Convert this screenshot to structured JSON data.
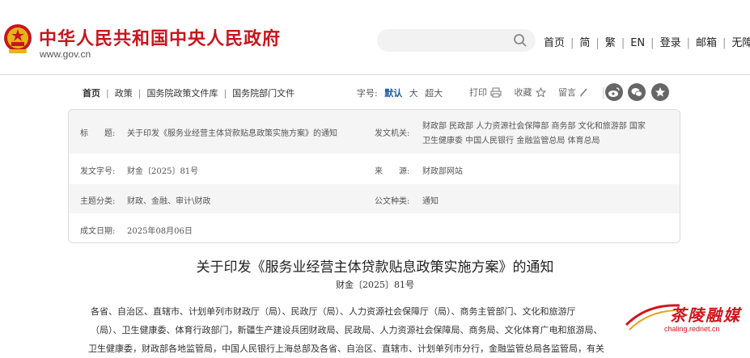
{
  "header": {
    "site_title": "中华人民共和国中央人民政府",
    "site_url": "www.gov.cn",
    "search_placeholder": "",
    "nav": [
      "首页",
      "简",
      "繁",
      "EN",
      "登录",
      "邮箱",
      "无障碍"
    ]
  },
  "toolbar": {
    "breadcrumbs": [
      "首页",
      "政策",
      "国务院政策文件库",
      "国务院部门文件"
    ],
    "fontsize_label": "字号:",
    "fontsize_options": [
      "默认",
      "大",
      "超大"
    ],
    "print_label": "打印",
    "favorite_label": "收藏",
    "message_label": "留言"
  },
  "info": {
    "title_label": "标　　题:",
    "title_value": "关于印发《服务业经营主体贷款贴息政策实施方案》的通知",
    "issuer_label": "发文机关:",
    "issuer_value_1": "财政部 民政部 人力资源社会保障部 商务部 文化和旅游部 国家",
    "issuer_value_2": "卫生健康委 中国人民银行 金融监管总局 体育总局",
    "docno_label": "发文字号:",
    "docno_value": "财金〔2025〕81号",
    "source_label": "来　　源:",
    "source_value": "财政部网站",
    "topic_label": "主题分类:",
    "topic_value": "财政、金融、审计\\财政",
    "type_label": "公文种类:",
    "type_value": "通知",
    "date_label": "成文日期:",
    "date_value": "2025年08月06日"
  },
  "document": {
    "title": "关于印发《服务业经营主体贷款贴息政策实施方案》的通知",
    "number": "财金〔2025〕81号",
    "lines": [
      "各省、自治区、直辖市、计划单列市财政厅（局）、民政厅（局）、人力资源社会保障厅（局）、商务主管部门、文化和旅游厅",
      "（局）、卫生健康委、体育行政部门，新疆生产建设兵团财政局、民政局、人力资源社会保障局、商务局、文化体育广电和旅游局、",
      "卫生健康委，财政部各地监管局，中国人民银行上海总部及各省、自治区、直辖市、计划单列市分行，金融监管总局各监管局，有关"
    ]
  },
  "watermark": {
    "brand": "茶陵融媒",
    "url": "chaling.rednet.cn"
  },
  "colors": {
    "brand_red": "#c8161e",
    "link_blue": "#1a5fa8",
    "panel_shade": "#f5f5f5"
  }
}
